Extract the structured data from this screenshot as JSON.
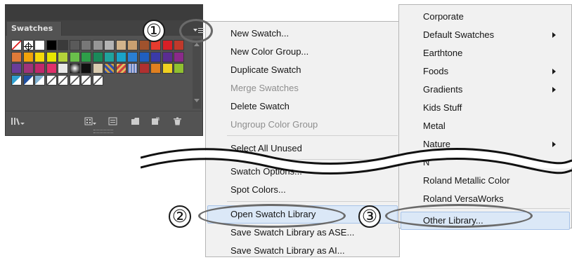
{
  "panel": {
    "tab_label": "Swatches",
    "menu_icon": "hamburger-menu-icon",
    "bottom_icons": [
      "swatch-libraries-menu-icon",
      "show-swatch-kinds-icon",
      "swatch-options-icon",
      "new-color-group-icon",
      "new-swatch-icon",
      "delete-swatch-icon"
    ]
  },
  "callouts": {
    "one": "①",
    "two": "②",
    "three": "③"
  },
  "menu_main": {
    "items": [
      {
        "label": "New Swatch...",
        "disabled": false
      },
      {
        "label": "New Color Group...",
        "disabled": false
      },
      {
        "label": "Duplicate Swatch",
        "disabled": false
      },
      {
        "label": "Merge Swatches",
        "disabled": true
      },
      {
        "label": "Delete Swatch",
        "disabled": false
      },
      {
        "label": "Ungroup Color Group",
        "disabled": true
      },
      {
        "label": "Select All Unused",
        "disabled": false
      },
      {
        "label": "Swatch Options...",
        "disabled": false
      },
      {
        "label": "Spot Colors...",
        "disabled": false
      },
      {
        "label": "Open Swatch Library",
        "disabled": false
      },
      {
        "label": "Save Swatch Library as ASE...",
        "disabled": false
      },
      {
        "label": "Save Swatch Library as AI...",
        "disabled": false
      }
    ]
  },
  "menu_library": {
    "items": [
      {
        "label": "Corporate",
        "submenu": false
      },
      {
        "label": "Default Swatches",
        "submenu": true
      },
      {
        "label": "Earthtone",
        "submenu": false
      },
      {
        "label": "Foods",
        "submenu": true
      },
      {
        "label": "Gradients",
        "submenu": true
      },
      {
        "label": "Kids Stuff",
        "submenu": false
      },
      {
        "label": "Metal",
        "submenu": false
      },
      {
        "label": "Nature",
        "submenu": true
      },
      {
        "label": "N",
        "submenu": false
      },
      {
        "label": "Roland Metallic Color",
        "submenu": false
      },
      {
        "label": "Roland VersaWorks",
        "submenu": false
      },
      {
        "label": "Other Library...",
        "submenu": false
      }
    ]
  },
  "colors": {
    "panel_bg": "#535353",
    "menu_bg": "#f1f1f1",
    "highlight": "#dbe8f7"
  }
}
